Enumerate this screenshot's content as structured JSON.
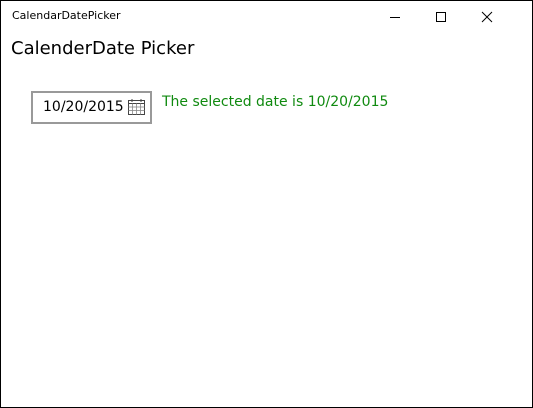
{
  "window": {
    "title": "CalendarDatePicker"
  },
  "page": {
    "heading": "CalenderDate Picker"
  },
  "date_picker": {
    "value": "10/20/2015",
    "icon": "calendar-icon"
  },
  "status": {
    "selected_text": "The selected date is 10/20/2015",
    "color": "#108a10"
  }
}
